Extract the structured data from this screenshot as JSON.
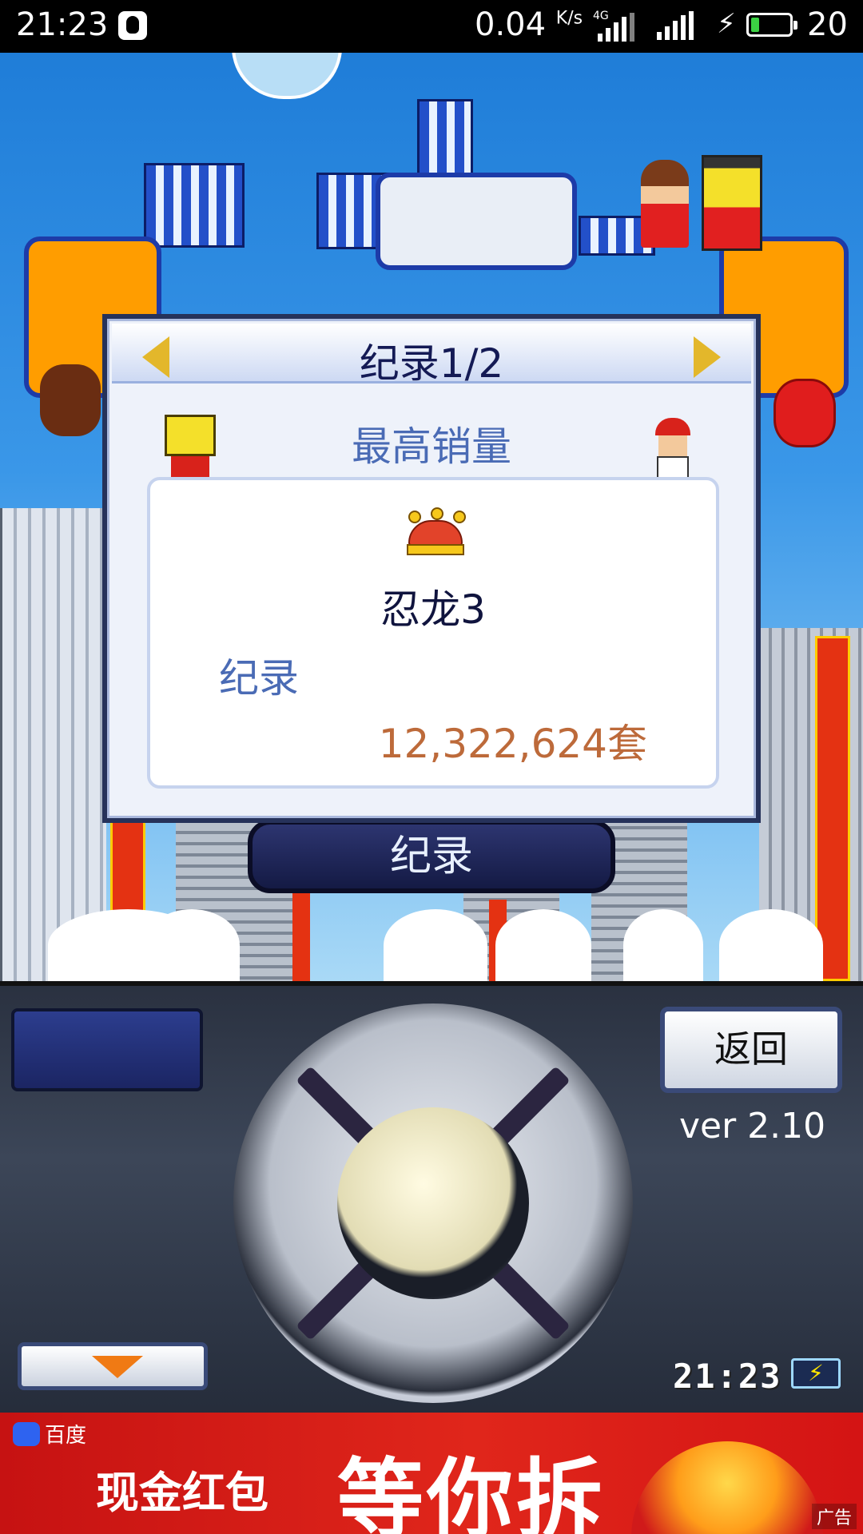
{
  "status_bar": {
    "time": "21:23",
    "network_speed": "0.04",
    "speed_unit": "K/s",
    "network_type": "4G",
    "battery_level": "20",
    "battery_fill": 0.2
  },
  "menu": {
    "record_button": "纪录"
  },
  "dialog": {
    "title": "纪录1/2",
    "subtitle": "最高销量",
    "game_name": "忍龙3",
    "record_label": "纪录",
    "record_value": "12,322,624套"
  },
  "controls": {
    "back_button": "返回",
    "version": "ver 2.10",
    "clock": "21:23"
  },
  "ad": {
    "brand": "百度",
    "text": "现金红包",
    "headline": "等你拆",
    "ad_mark": "广告"
  },
  "colors": {
    "dialog_title": "#141a55",
    "dialog_accent": "#4a6bb5",
    "record_value": "#bd6a3a",
    "ad_background": "#d41414"
  }
}
